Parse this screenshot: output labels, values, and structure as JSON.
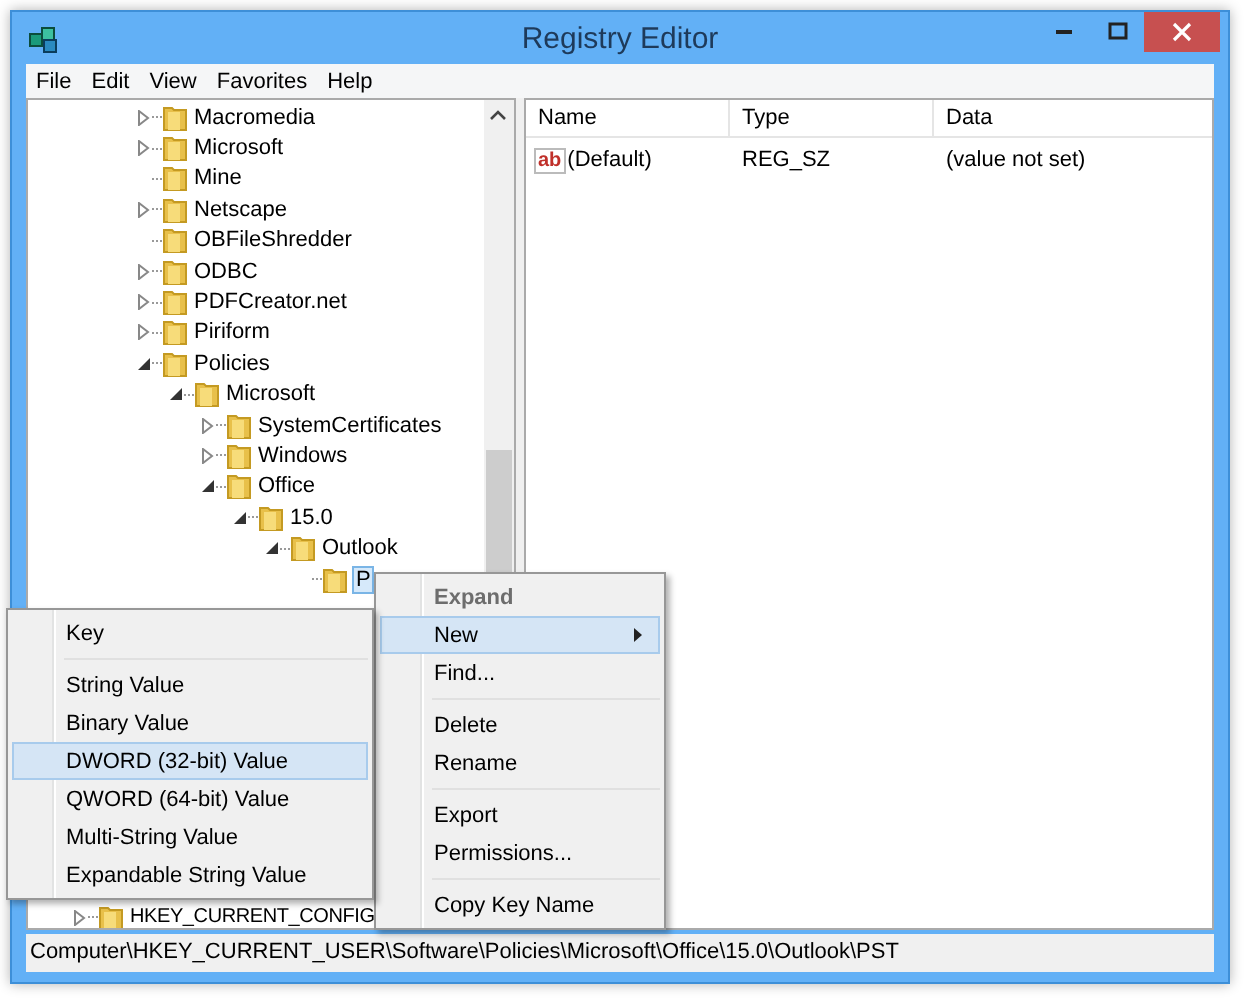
{
  "window": {
    "title": "Registry Editor"
  },
  "menu_bar": [
    "File",
    "Edit",
    "View",
    "Favorites",
    "Help"
  ],
  "tree": {
    "items": [
      {
        "label": "Macromedia",
        "expanded": false,
        "selected": false
      },
      {
        "label": "Microsoft",
        "expanded": false,
        "selected": false
      },
      {
        "label": "Mine",
        "selected": false
      },
      {
        "label": "Netscape",
        "expanded": false,
        "selected": false
      },
      {
        "label": "OBFileShredder",
        "selected": false
      },
      {
        "label": "ODBC",
        "expanded": false,
        "selected": false
      },
      {
        "label": "PDFCreator.net",
        "expanded": false,
        "selected": false
      },
      {
        "label": "Piriform",
        "expanded": false,
        "selected": false
      },
      {
        "label": "Policies",
        "expanded": true,
        "selected": false,
        "children": [
          {
            "label": "Microsoft",
            "expanded": true,
            "selected": false,
            "children": [
              {
                "label": "SystemCertificates",
                "expanded": false,
                "selected": false
              },
              {
                "label": "Windows",
                "expanded": false,
                "selected": false
              },
              {
                "label": "Office",
                "expanded": true,
                "selected": false,
                "children": [
                  {
                    "label": "15.0",
                    "expanded": true,
                    "selected": false,
                    "children": [
                      {
                        "label": "Outlook",
                        "expanded": true,
                        "selected": false,
                        "children": [
                          {
                            "label": "P",
                            "selected": true
                          }
                        ]
                      }
                    ]
                  }
                ]
              }
            ]
          }
        ]
      }
    ],
    "root_items": [
      {
        "label": "HKEY_CURRENT_CONFIG",
        "expanded": false,
        "selected": false
      }
    ]
  },
  "values": {
    "columns": [
      "Name",
      "Type",
      "Data"
    ],
    "rows": [
      {
        "icon_text": "ab",
        "name": "(Default)",
        "type": "REG_SZ",
        "data": "(value not set)"
      }
    ]
  },
  "status_bar": "Computer\\HKEY_CURRENT_USER\\Software\\Policies\\Microsoft\\Office\\15.0\\Outlook\\PST",
  "context_menu": {
    "groups": [
      [
        {
          "label": "Expand",
          "default": true,
          "disabled": true,
          "selected": false,
          "has_submenu": false
        },
        {
          "label": "New",
          "default": false,
          "disabled": false,
          "selected": true,
          "has_submenu": true
        },
        {
          "label": "Find...",
          "default": false,
          "disabled": false,
          "selected": false,
          "has_submenu": false
        }
      ],
      [
        {
          "label": "Delete",
          "default": false,
          "disabled": false,
          "selected": false,
          "has_submenu": false
        },
        {
          "label": "Rename",
          "default": false,
          "disabled": false,
          "selected": false,
          "has_submenu": false
        }
      ],
      [
        {
          "label": "Export",
          "default": false,
          "disabled": false,
          "selected": false,
          "has_submenu": false
        },
        {
          "label": "Permissions...",
          "default": false,
          "disabled": false,
          "selected": false,
          "has_submenu": false
        }
      ],
      [
        {
          "label": "Copy Key Name",
          "default": false,
          "disabled": false,
          "selected": false,
          "has_submenu": false
        }
      ]
    ]
  },
  "submenu": {
    "groups": [
      [
        {
          "label": "Key",
          "selected": false
        }
      ],
      [
        {
          "label": "String Value",
          "selected": false
        },
        {
          "label": "Binary Value",
          "selected": false
        },
        {
          "label": "DWORD (32-bit) Value",
          "selected": true
        },
        {
          "label": "QWORD (64-bit) Value",
          "selected": false
        },
        {
          "label": "Multi-String Value",
          "selected": false
        },
        {
          "label": "Expandable String Value",
          "selected": false
        }
      ]
    ]
  }
}
